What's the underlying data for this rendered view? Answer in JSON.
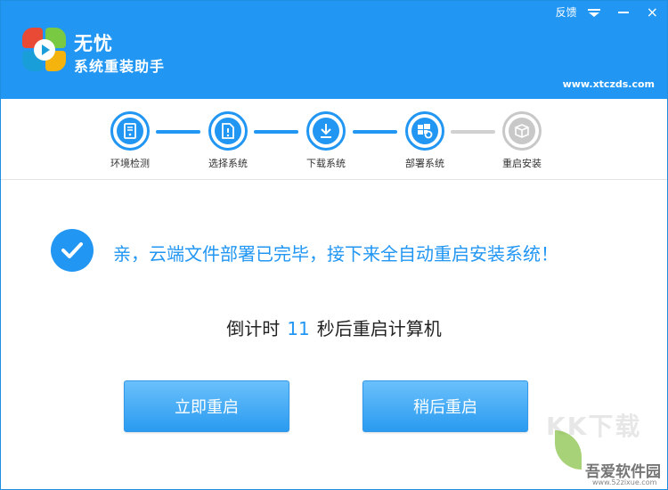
{
  "header": {
    "title_line1": "无忧",
    "title_line2": "系统重装助手",
    "feedback": "反馈",
    "website": "www.xtczds.com",
    "close_glyph": "×"
  },
  "steps": [
    {
      "label": "环境检测",
      "icon": "computer-icon",
      "state": "done"
    },
    {
      "label": "选择系统",
      "icon": "file-icon",
      "state": "done"
    },
    {
      "label": "下载系统",
      "icon": "download-icon",
      "state": "done"
    },
    {
      "label": "部署系统",
      "icon": "windows-gear-icon",
      "state": "done"
    },
    {
      "label": "重启安装",
      "icon": "box-icon",
      "state": "pending"
    }
  ],
  "message": "亲，云端文件部署已完毕，接下来全自动重启安装系统！",
  "countdown": {
    "prefix": "倒计时",
    "seconds": "11",
    "suffix": "秒后重启计算机"
  },
  "buttons": {
    "restart_now": "立即重启",
    "restart_later": "稍后重启"
  },
  "watermark": {
    "big": "KK下载",
    "text": "吾爱软件园",
    "url": "www.52zixue.com"
  },
  "colors": {
    "accent": "#2196f3",
    "disabled": "#c8c8c8"
  }
}
